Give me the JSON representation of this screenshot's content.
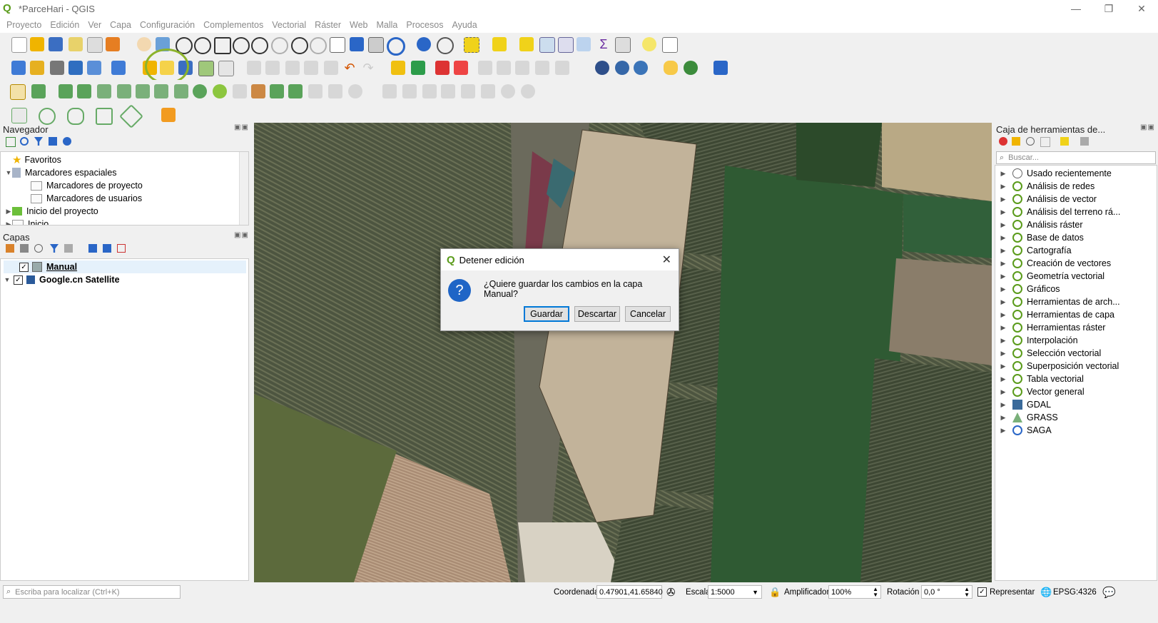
{
  "window": {
    "title": "*ParceHari - QGIS",
    "controls": [
      "—",
      "❐",
      "✕"
    ]
  },
  "menu": [
    "Proyecto",
    "Edición",
    "Ver",
    "Capa",
    "Configuración",
    "Complementos",
    "Vectorial",
    "Ráster",
    "Web",
    "Malla",
    "Procesos",
    "Ayuda"
  ],
  "navigator": {
    "title": "Navegador",
    "items": [
      {
        "label": "Favoritos"
      },
      {
        "label": "Marcadores espaciales"
      },
      {
        "label": "Marcadores de proyecto"
      },
      {
        "label": "Marcadores de usuarios"
      },
      {
        "label": "Inicio del proyecto"
      },
      {
        "label": "Inicio"
      }
    ]
  },
  "layers": {
    "title": "Capas",
    "items": [
      {
        "label": "Manual",
        "checked": true
      },
      {
        "label": "Google.cn Satellite",
        "checked": true
      }
    ]
  },
  "toolbox": {
    "title": "Caja de herramientas de...",
    "search_placeholder": "Buscar...",
    "items": [
      {
        "label": "Usado recientemente"
      },
      {
        "label": "Análisis de redes"
      },
      {
        "label": "Análisis de vector"
      },
      {
        "label": "Análisis del terreno rá..."
      },
      {
        "label": "Análisis ráster"
      },
      {
        "label": "Base de datos"
      },
      {
        "label": "Cartografía"
      },
      {
        "label": "Creación de vectores"
      },
      {
        "label": "Geometría vectorial"
      },
      {
        "label": "Gráficos"
      },
      {
        "label": "Herramientas de arch..."
      },
      {
        "label": "Herramientas de capa"
      },
      {
        "label": "Herramientas ráster"
      },
      {
        "label": "Interpolación"
      },
      {
        "label": "Selección vectorial"
      },
      {
        "label": "Superposición vectorial"
      },
      {
        "label": "Tabla vectorial"
      },
      {
        "label": "Vector general"
      },
      {
        "label": "GDAL"
      },
      {
        "label": "GRASS"
      },
      {
        "label": "SAGA"
      }
    ]
  },
  "dialog": {
    "title": "Detener edición",
    "message": "¿Quiere guardar los cambios en la capa Manual?",
    "icon_glyph": "?",
    "buttons": {
      "save": "Guardar",
      "discard": "Descartar",
      "cancel": "Cancelar"
    }
  },
  "statusbar": {
    "locator_placeholder": "Escriba para localizar (Ctrl+K)",
    "coord_label": "Coordenada",
    "coord_value": "0.47901,41.65840",
    "scale_label": "Escala",
    "scale_value": "1:5000",
    "magnifier_label": "Amplificador",
    "magnifier_value": "100%",
    "rotation_label": "Rotación",
    "rotation_value": "0,0 °",
    "render_label": "Representar",
    "crs": "EPSG:4326"
  },
  "colors": {
    "accent_green": "#5a9b1a",
    "highlight_ring": "#8cb32b",
    "polygon_fill": "#c2b39a",
    "dialog_icon": "#1f65c6"
  }
}
